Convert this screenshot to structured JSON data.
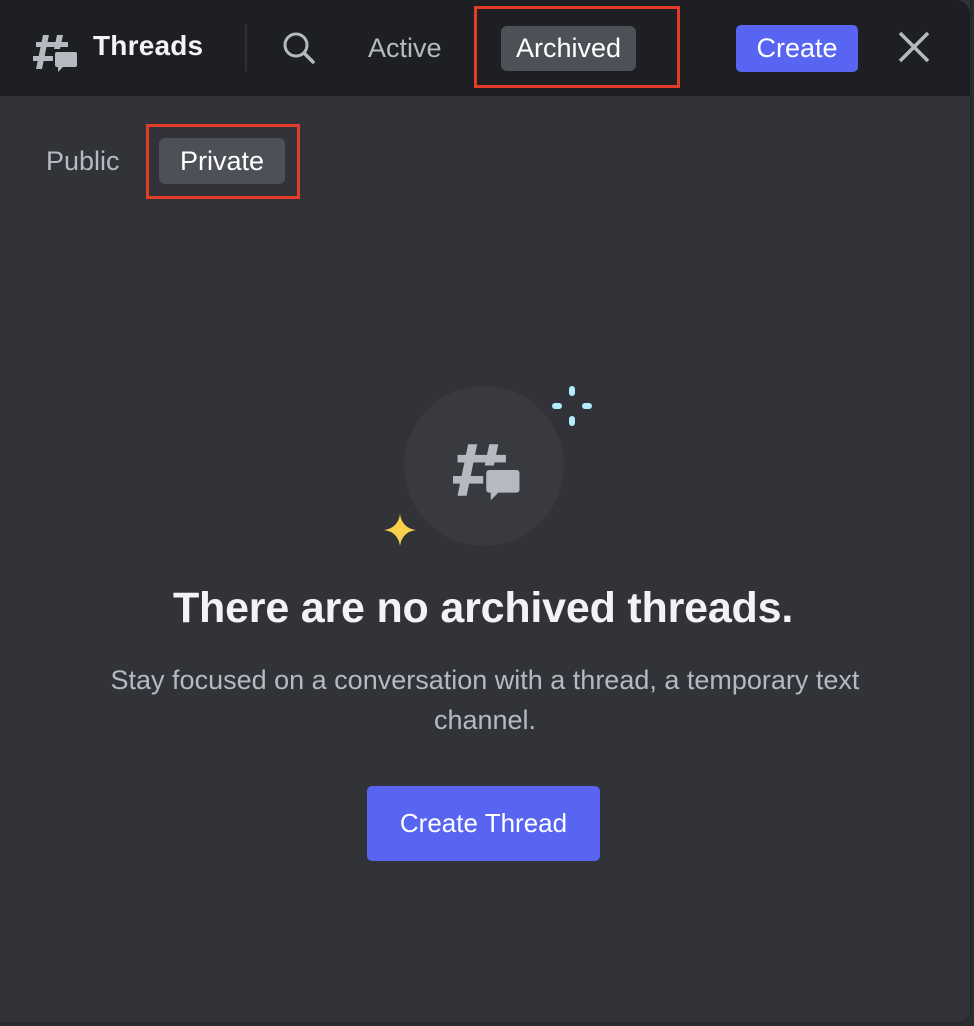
{
  "header": {
    "title": "Threads",
    "title_icon": "threads-icon",
    "search_icon": "search-icon",
    "tabs": [
      {
        "label": "Active",
        "selected": false
      },
      {
        "label": "Archived",
        "selected": true
      }
    ],
    "create_label": "Create",
    "close_icon": "close-icon"
  },
  "subtabs": [
    {
      "label": "Public",
      "selected": false
    },
    {
      "label": "Private",
      "selected": true
    }
  ],
  "empty_state": {
    "icon": "threads-icon",
    "title": "There are no archived threads.",
    "description": "Stay focused on a conversation with a thread, a temporary text channel.",
    "button_label": "Create Thread"
  },
  "colors": {
    "accent": "#5865f2",
    "highlight": "#e23d28",
    "spark_blue": "#b3ecff",
    "spark_yellow": "#f8d049"
  }
}
